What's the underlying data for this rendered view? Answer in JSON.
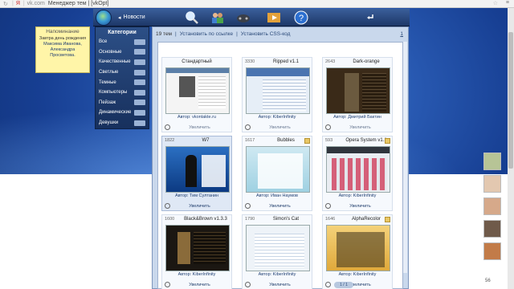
{
  "browser": {
    "domain": "vk.com",
    "title": "Менеджер тем | [vkOpt]"
  },
  "taskbar": {
    "news_label": "Новости"
  },
  "reminder": {
    "title": "Напоминание",
    "line1": "Завтра день рождения",
    "line2": "Максима Иванова,",
    "line3": "Александра Просветова."
  },
  "categories": {
    "title": "Категории",
    "items": [
      "Все",
      "Основные",
      "Качественные",
      "Светлые",
      "Темные",
      "Компьютеры",
      "Пейзаж",
      "Динамические",
      "Девушки"
    ]
  },
  "toolbar": {
    "count": "19 тем",
    "install_link": "Установить по ссылке",
    "install_css": "Установить CSS-код",
    "page": "1"
  },
  "themes": [
    {
      "rating": "",
      "name": "Стандартный",
      "author": "Автор: vkontakte.ru",
      "enlarge": "Увеличить"
    },
    {
      "rating": "3330",
      "name": "Ripped v1.1",
      "author": "Автор: KiberInfinity",
      "enlarge": "Увеличить"
    },
    {
      "rating": "2643",
      "name": "Dark-orange",
      "author": "Автор: Дмитрий Бактин",
      "enlarge": "Увеличить"
    },
    {
      "rating": "1822",
      "name": "W7",
      "author": "Автор: Тим Султанин",
      "enlarge": "Увеличить"
    },
    {
      "rating": "1617",
      "name": "Bubbles",
      "author": "Автор: Иван Наумов",
      "enlarge": "Увеличить"
    },
    {
      "rating": "593",
      "name": "Opera System v1.1",
      "author": "Автор: KiberInfinity",
      "enlarge": "Увеличить"
    },
    {
      "rating": "1600",
      "name": "Black&Brown v1.3.3",
      "author": "Автор: KiberInfinity",
      "enlarge": "Увеличить"
    },
    {
      "rating": "1790",
      "name": "Simon's Cat",
      "author": "Автор: KiberInfinity",
      "enlarge": "Увеличить"
    },
    {
      "rating": "1646",
      "name": "AlphaRecolor",
      "author": "Автор: KiberInfinity",
      "enlarge": "Увеличить"
    }
  ],
  "online": {
    "count": "56"
  }
}
